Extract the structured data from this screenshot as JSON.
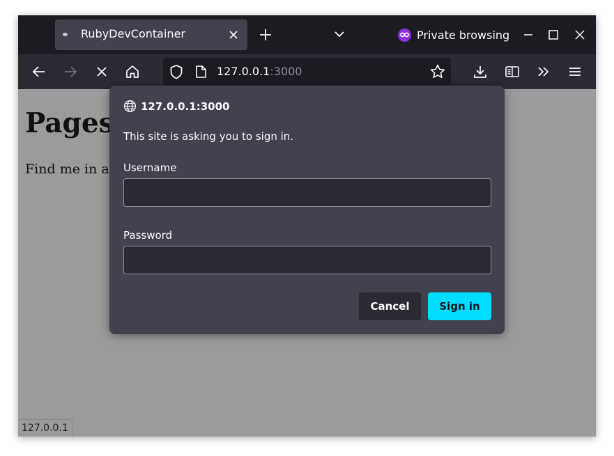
{
  "browser": {
    "tab": {
      "title": "RubyDevContainer",
      "favicon": "page-icon"
    },
    "private_label": "Private browsing",
    "url": {
      "host": "127.0.0.1",
      "port": ":3000"
    },
    "colors": {
      "accent": "#00ddff",
      "private": "#8f2ee6",
      "dialog_bg": "#42414d"
    }
  },
  "page": {
    "heading": "Pages",
    "text": "Find me in a",
    "status_text": "127.0.0.1"
  },
  "dialog": {
    "origin": "127.0.0.1:3000",
    "message": "This site is asking you to sign in.",
    "username_label": "Username",
    "username_value": "",
    "password_label": "Password",
    "password_value": "",
    "cancel_label": "Cancel",
    "signin_label": "Sign in"
  }
}
